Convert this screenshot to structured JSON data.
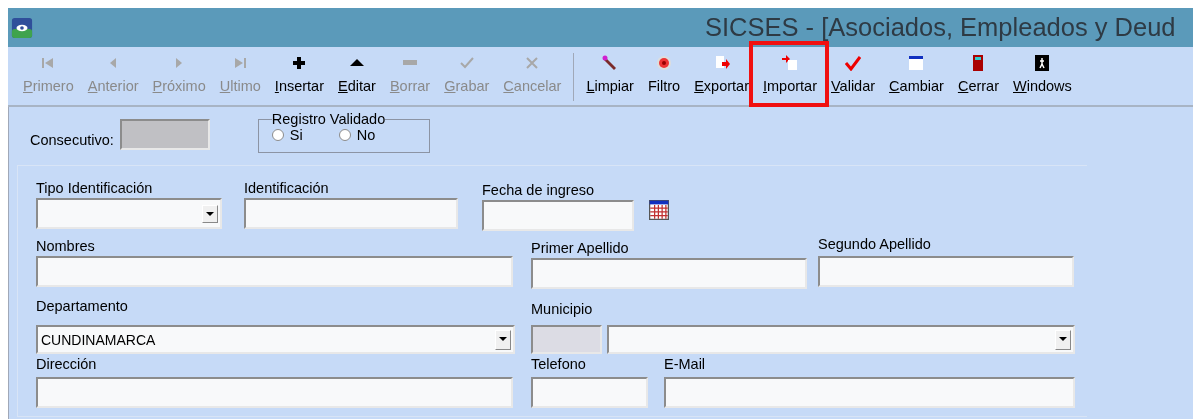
{
  "window": {
    "title": "SICSES - [Asociados, Empleados y Deud"
  },
  "toolbar": {
    "buttons": [
      {
        "label": "Primero",
        "disabled": true,
        "mnemonic": true,
        "highlighted": false
      },
      {
        "label": "Anterior",
        "disabled": true,
        "mnemonic": true,
        "highlighted": false
      },
      {
        "label": "Próximo",
        "disabled": true,
        "mnemonic": true,
        "highlighted": false
      },
      {
        "label": "Ultimo",
        "disabled": true,
        "mnemonic": true,
        "highlighted": false
      },
      {
        "label": "Insertar",
        "disabled": false,
        "mnemonic": true,
        "highlighted": false
      },
      {
        "label": "Editar",
        "disabled": false,
        "mnemonic": true,
        "highlighted": false
      },
      {
        "label": "Borrar",
        "disabled": true,
        "mnemonic": true,
        "highlighted": false
      },
      {
        "label": "Grabar",
        "disabled": true,
        "mnemonic": true,
        "highlighted": false
      },
      {
        "label": "Cancelar",
        "disabled": true,
        "mnemonic": true,
        "highlighted": false
      },
      {
        "label": "Limpiar",
        "disabled": false,
        "mnemonic": true,
        "highlighted": false
      },
      {
        "label": "Filtro",
        "disabled": false,
        "mnemonic": false,
        "highlighted": false
      },
      {
        "label": "Exportar",
        "disabled": false,
        "mnemonic": true,
        "highlighted": false
      },
      {
        "label": "Importar",
        "disabled": false,
        "mnemonic": true,
        "highlighted": true
      },
      {
        "label": "Validar",
        "disabled": false,
        "mnemonic": true,
        "highlighted": false
      },
      {
        "label": "Cambiar",
        "disabled": false,
        "mnemonic": true,
        "highlighted": false
      },
      {
        "label": "Cerrar",
        "disabled": false,
        "mnemonic": true,
        "highlighted": false
      },
      {
        "label": "Windows",
        "disabled": false,
        "mnemonic": true,
        "highlighted": false
      }
    ]
  },
  "header": {
    "consecutivo": {
      "label": "Consecutivo:",
      "readonly": true
    },
    "registro_validado": {
      "legend": "Registro Validado",
      "options": [
        {
          "label": "Si",
          "selected": false
        },
        {
          "label": "No",
          "selected": false
        }
      ]
    }
  },
  "form_rows": [
    [
      {
        "label": "Tipo Identificación",
        "kind": "combo"
      },
      {
        "label": "Identificación",
        "kind": "text"
      },
      {
        "label": "Fecha de ingreso",
        "kind": "date"
      }
    ],
    [
      {
        "label": "Nombres",
        "kind": "text"
      },
      {
        "label": "Primer Apellido",
        "kind": "text"
      },
      {
        "label": "Segundo Apellido",
        "kind": "text"
      }
    ],
    [
      {
        "label": "Departamento",
        "kind": "combo",
        "value": "CUNDINAMARCA"
      },
      {
        "label": "Municipio",
        "kind": "code"
      },
      {
        "kind": "combo"
      }
    ],
    [
      {
        "label": "Dirección",
        "kind": "text"
      },
      {
        "label": "Telefono",
        "kind": "text"
      },
      {
        "label": "E-Mail",
        "kind": "text"
      }
    ]
  ]
}
